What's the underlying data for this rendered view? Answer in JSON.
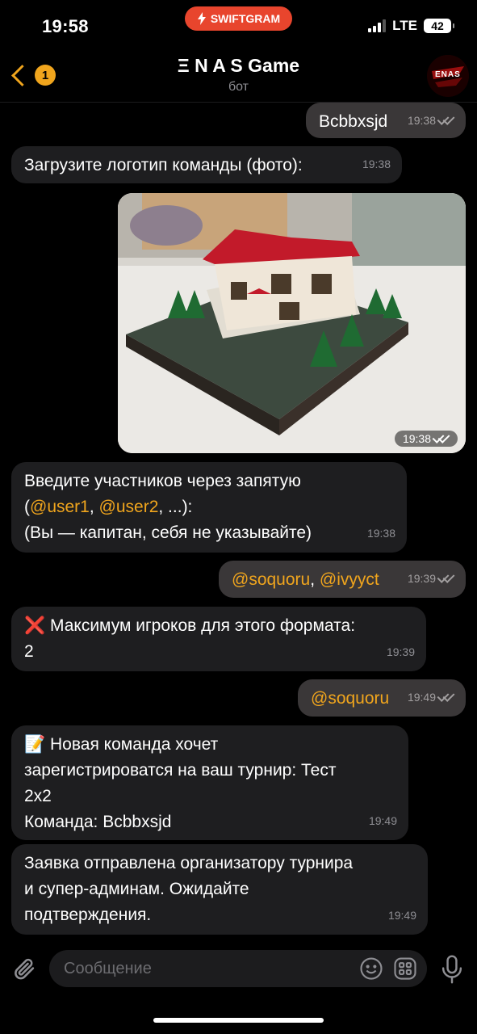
{
  "status_bar": {
    "time": "19:58",
    "app_pill": "SWIFTGRAM",
    "network": "LTE",
    "battery": "42"
  },
  "header": {
    "back_badge": "1",
    "title": "Ξ N A S Game",
    "subtitle": "бот",
    "avatar_text": "ENAS"
  },
  "messages": [
    {
      "dir": "out",
      "text": "Bcbbxsjd",
      "time": "19:38"
    },
    {
      "dir": "in",
      "text": "Загрузите логотип команды (фото):",
      "time": "19:38"
    },
    {
      "dir": "out",
      "type": "photo",
      "time": "19:38"
    },
    {
      "dir": "in",
      "line1": "Введите участников через запятую",
      "line2_mention1": "@user1",
      "line2_mention2": "@user2",
      "line2_rest": ", ...):",
      "line3": "(Вы — капитан, себя не указывайте)",
      "time": "19:38"
    },
    {
      "dir": "out",
      "mention1": "@soquoru",
      "mention2": "@ivyyct",
      "time": "19:39"
    },
    {
      "dir": "in",
      "icon": "❌",
      "line1": "Максимум игроков для этого формата:",
      "line2": "2",
      "time": "19:39"
    },
    {
      "dir": "out",
      "mention1": "@soquoru",
      "time": "19:49"
    },
    {
      "dir": "in",
      "icon": "📝",
      "line1": "Новая команда хочет",
      "line2": "зарегистрироватся на ваш турнир: Тест",
      "line3": "2x2",
      "line4": "Команда: Bcbbxsjd",
      "time": "19:49"
    },
    {
      "dir": "in",
      "line1": "Заявка отправлена организатору турнира",
      "line2": "и супер-админам. Ожидайте",
      "line3": "подтверждения.",
      "time": "19:49"
    }
  ],
  "input": {
    "placeholder": "Сообщение"
  },
  "colors": {
    "accent": "#f0a51d",
    "incoming_bubble": "#1e1e20",
    "outgoing_bubble": "#3a3738",
    "pill": "#e8452d"
  }
}
